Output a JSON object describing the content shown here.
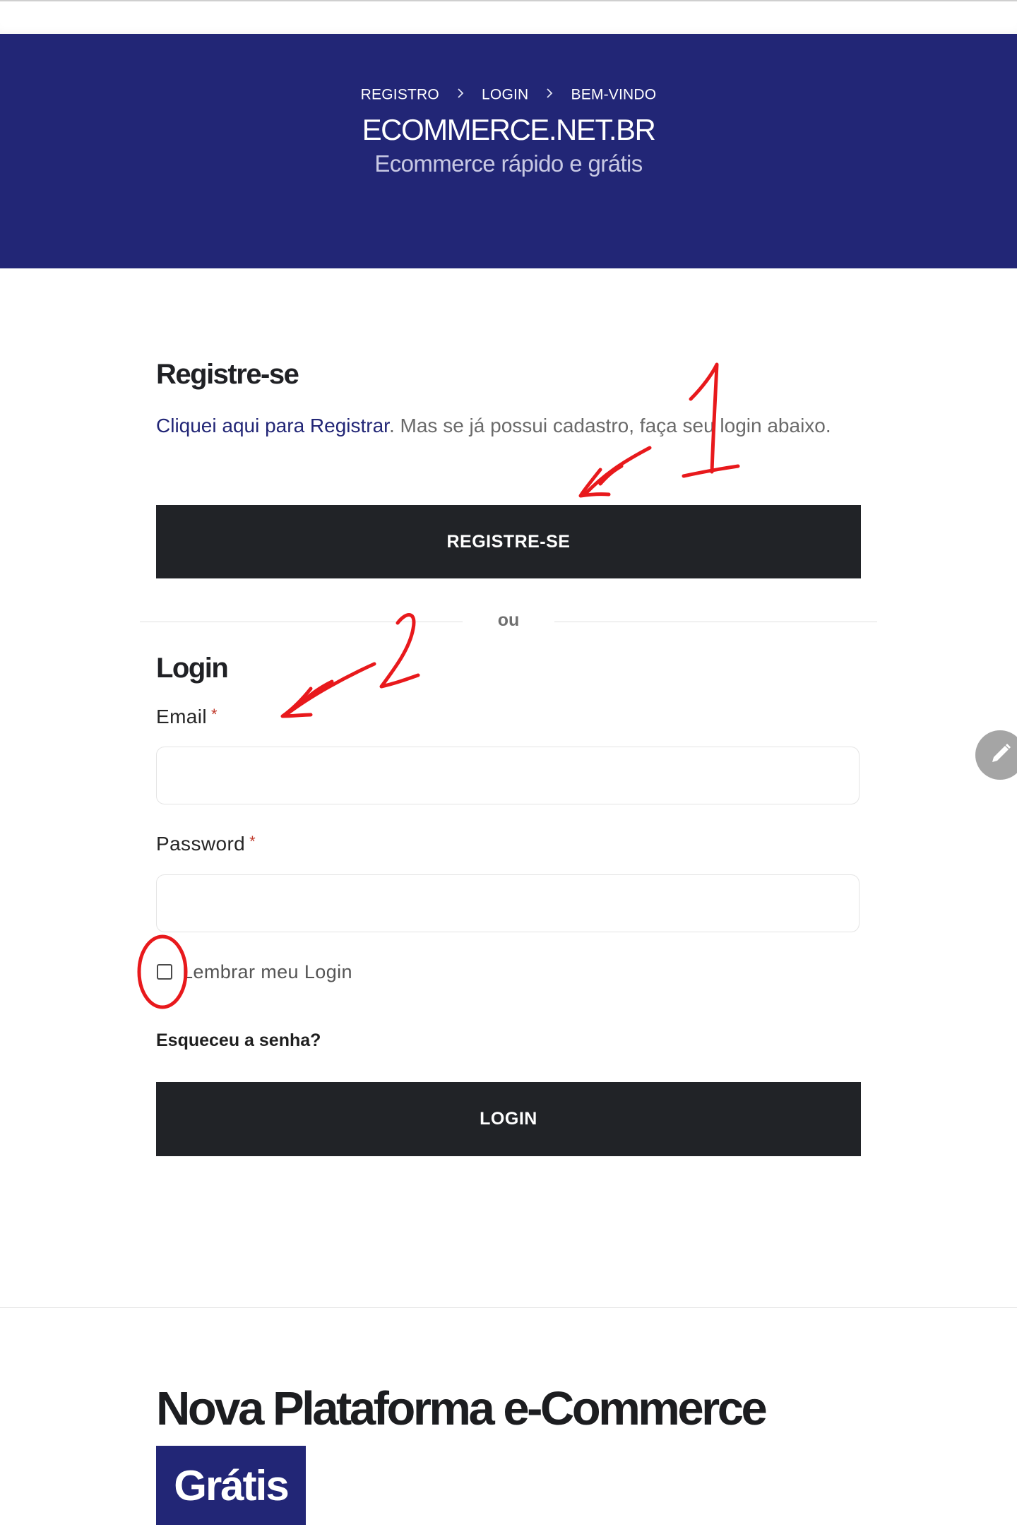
{
  "breadcrumb": {
    "items": [
      "REGISTRO",
      "LOGIN",
      "BEM-VINDO"
    ],
    "separator": "›"
  },
  "header": {
    "title": "ECOMMERCE.NET.BR",
    "subtitle": "Ecommerce rápido e grátis"
  },
  "register": {
    "heading": "Registre-se",
    "link_text": "Cliquei aqui para Registrar",
    "text_after": ". Mas se já possui cadastro, faça seu login abaixo.",
    "button_label": "REGISTRE-SE"
  },
  "divider": {
    "label": "ou"
  },
  "login": {
    "heading": "Login",
    "email_label": "Email",
    "email_value": "",
    "password_label": "Password",
    "password_value": "",
    "required_mark": "*",
    "remember_label": "Lembrar meu Login",
    "remember_checked": false,
    "forgot_label": "Esqueceu a senha?",
    "button_label": "LOGIN"
  },
  "promo": {
    "title": "Nova Plataforma e-Commerce",
    "badge": "Grátis"
  },
  "annotations": {
    "marks": [
      "1",
      "2",
      "0"
    ],
    "color": "#e8191c"
  },
  "colors": {
    "brand_blue": "#222676",
    "button_dark": "#212327",
    "link": "#222676",
    "required": "#c0392b"
  },
  "icons": {
    "edit_fab": "pencil-icon",
    "crumb_sep": "chevron-right-icon"
  }
}
